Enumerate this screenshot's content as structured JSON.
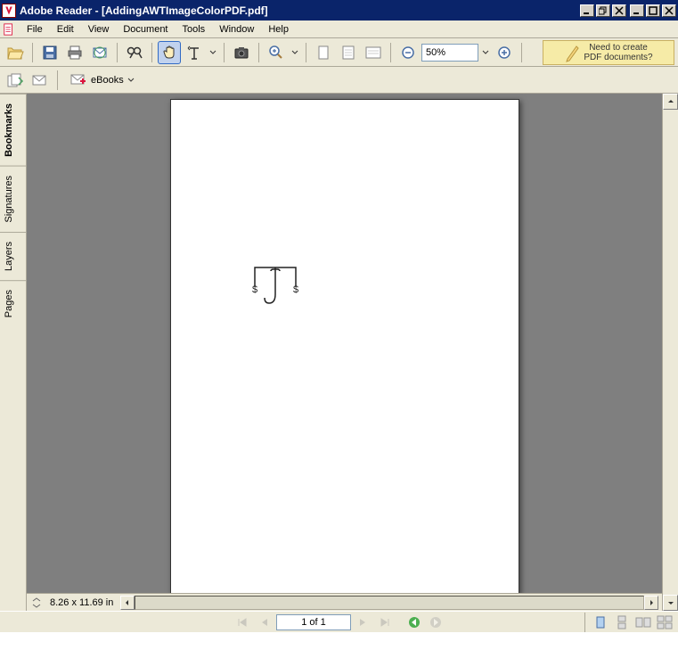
{
  "titlebar": {
    "app_name": "Adobe Reader",
    "doc_name": "[AddingAWTImageColorPDF.pdf]",
    "full": "Adobe Reader - [AddingAWTImageColorPDF.pdf]"
  },
  "menu": {
    "file": "File",
    "edit": "Edit",
    "view": "View",
    "document": "Document",
    "tools": "Tools",
    "window": "Window",
    "help": "Help"
  },
  "toolbar": {
    "zoom_value": "50%",
    "ebooks_label": "eBooks"
  },
  "promo": {
    "line1": "Need to create",
    "line2": "PDF documents?"
  },
  "nav_tabs": {
    "bookmarks": "Bookmarks",
    "signatures": "Signatures",
    "layers": "Layers",
    "pages": "Pages"
  },
  "status": {
    "page_size": "8.26 x 11.69 in"
  },
  "pagenav": {
    "current": "1 of 1"
  }
}
